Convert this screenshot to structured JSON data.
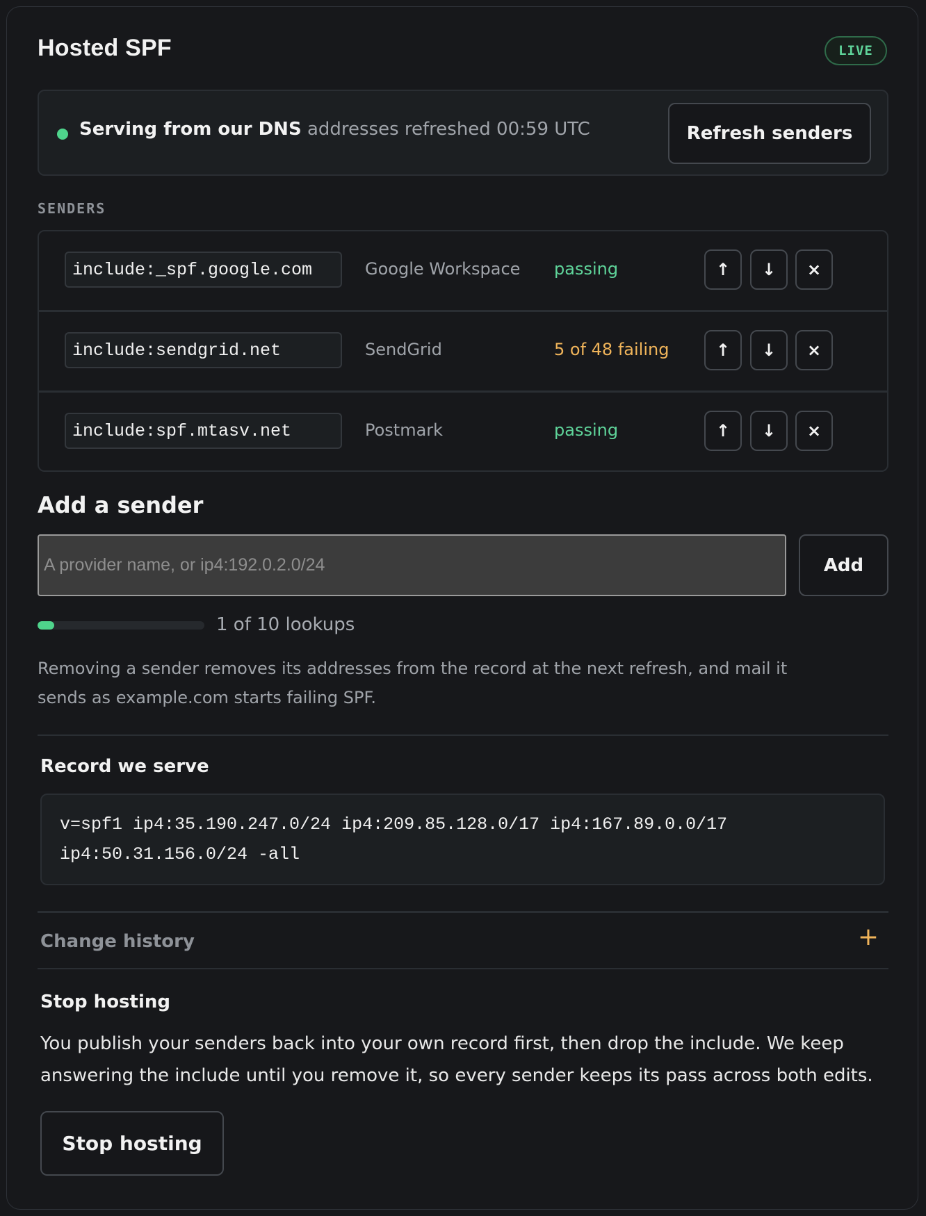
{
  "header": {
    "title": "Hosted SPF",
    "badge": "LIVE"
  },
  "status": {
    "strong": "Serving from our DNS",
    "detail": "addresses refreshed 00:59 UTC",
    "refresh_button": "Refresh senders"
  },
  "senders": {
    "label": "SENDERS",
    "rows": [
      {
        "mechanism": "include:_spf.google.com",
        "provider": "Google Workspace",
        "state": "passing",
        "state_kind": "pass"
      },
      {
        "mechanism": "include:sendgrid.net",
        "provider": "SendGrid",
        "state": "5 of 48 failing",
        "state_kind": "fail"
      },
      {
        "mechanism": "include:spf.mtasv.net",
        "provider": "Postmark",
        "state": "passing",
        "state_kind": "pass"
      }
    ],
    "icons": {
      "up": "↑",
      "down": "↓",
      "remove": "×"
    }
  },
  "add_sender": {
    "title": "Add a sender",
    "placeholder": "A provider name, or ip4:192.0.2.0/24",
    "value": "",
    "button": "Add"
  },
  "lookups": {
    "text": "1 of 10 lookups",
    "used": 1,
    "limit": 10
  },
  "note": "Removing a sender removes its addresses from the record at the next refresh, and mail it sends as example.com starts failing SPF.",
  "record": {
    "title": "Record we serve",
    "value": "v=spf1 ip4:35.190.247.0/24 ip4:209.85.128.0/17 ip4:167.89.0.0/17\nip4:50.31.156.0/24 -all"
  },
  "history": {
    "label": "Change history",
    "toggle": "+"
  },
  "stop": {
    "title": "Stop hosting",
    "text": "You publish your senders back into your own record first, then drop the include. We keep answering the include until you remove it, so every sender keeps its pass across both edits.",
    "button": "Stop hosting"
  },
  "colors": {
    "accent_green": "#4fd48c",
    "warning": "#f0b45a",
    "background": "#17181b"
  }
}
